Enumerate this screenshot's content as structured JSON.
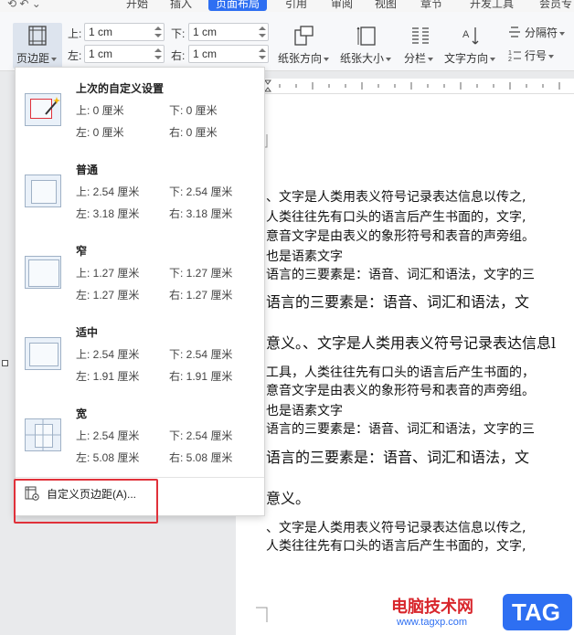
{
  "tabs": [
    "开始",
    "插入",
    "页面布局",
    "引用",
    "审阅",
    "视图",
    "章节",
    "开发工具",
    "会员专"
  ],
  "active_tab": "页面布局",
  "ribbon": {
    "margins_button": "页边距",
    "top_label": "上:",
    "top_value": "1 cm",
    "bottom_label": "下:",
    "bottom_value": "1 cm",
    "left_label": "左:",
    "left_value": "1 cm",
    "right_label": "右:",
    "right_value": "1 cm",
    "orientation": "纸张方向",
    "size": "纸张大小",
    "columns": "分栏",
    "text_direction": "文字方向",
    "separator": "分隔符",
    "line_numbers": "行号"
  },
  "margin_menu": {
    "options": [
      {
        "title": "上次的自定义设置",
        "top": "上: 0 厘米",
        "bottom": "下: 0 厘米",
        "left": "左: 0 厘米",
        "right": "右: 0 厘米"
      },
      {
        "title": "普通",
        "top": "上: 2.54 厘米",
        "bottom": "下: 2.54 厘米",
        "left": "左: 3.18 厘米",
        "right": "右: 3.18 厘米"
      },
      {
        "title": "窄",
        "top": "上: 1.27 厘米",
        "bottom": "下: 1.27 厘米",
        "left": "左: 1.27 厘米",
        "right": "右: 1.27 厘米"
      },
      {
        "title": "适中",
        "top": "上: 2.54 厘米",
        "bottom": "下: 2.54 厘米",
        "left": "左: 1.91 厘米",
        "right": "右: 1.91 厘米"
      },
      {
        "title": "宽",
        "top": "上: 2.54 厘米",
        "bottom": "下: 2.54 厘米",
        "left": "左: 5.08 厘米",
        "right": "右: 5.08 厘米"
      }
    ],
    "custom": "自定义页边距(A)..."
  },
  "document": {
    "lines": [
      "、文字是人类用表义符号记录表达信息以传之,",
      "人类往往先有口头的语言后产生书面的，文字,",
      "意音文字是由表义的象形符号和表音的声旁组。",
      "也是语素文字",
      "语言的三要素是：语音、词汇和语法，文字的三",
      "语言的三要素是：语音、词汇和语法，文",
      "意义。、文字是人类用表义符号记录表达信息l",
      "工具，人类往往先有口头的语言后产生书面的，",
      "意音文字是由表义的象形符号和表音的声旁组。",
      "也是语素文字",
      "语言的三要素是：语音、词汇和语法，文字的三",
      "语言的三要素是：语音、词汇和语法，文",
      "意义。",
      "、文字是人类用表义符号记录表达信息以传之,",
      "人类往往先有口头的语言后产生书面的，文字,"
    ]
  },
  "watermark": {
    "name": "电脑技术网",
    "url": "www.tagxp.com",
    "badge": "TAG"
  },
  "colors": {
    "accent": "#2e6ff2",
    "highlight": "#e0313a"
  }
}
